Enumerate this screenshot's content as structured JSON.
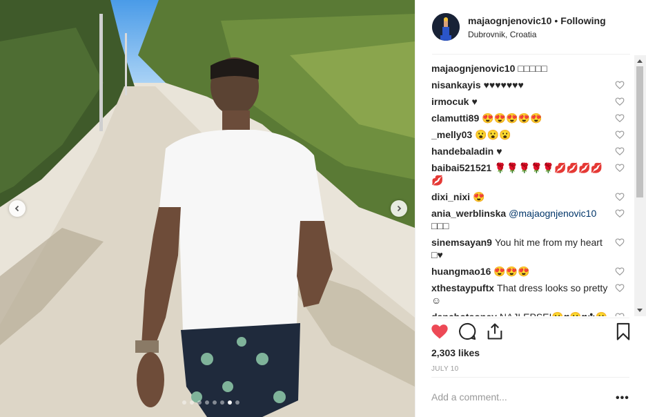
{
  "post": {
    "username": "majaognjenovic10",
    "separator": "•",
    "follow_status": "Following",
    "location": "Dubrovnik, Croatia"
  },
  "comments": [
    {
      "user": "majaognjenovic10",
      "text": "□□□□□",
      "likeable": false
    },
    {
      "user": "nisankayis",
      "text": "♥♥♥♥♥♥♥",
      "likeable": true
    },
    {
      "user": "irmocuk",
      "text": "♥",
      "likeable": true
    },
    {
      "user": "clamutti89",
      "text": "😍😍😍😍😍",
      "likeable": true
    },
    {
      "user": "_melly03",
      "text": "😮😮😮",
      "likeable": true
    },
    {
      "user": "handebaladin",
      "text": "♥",
      "likeable": true
    },
    {
      "user": "baibai521521",
      "text": "🌹🌹🌹🌹🌹💋💋💋💋💋",
      "likeable": true
    },
    {
      "user": "dixi_nixi",
      "text": "😍",
      "likeable": true
    },
    {
      "user": "ania_werblinska",
      "mention": "@majaognjenovic10",
      "text": "□□□",
      "likeable": true
    },
    {
      "user": "sinemsayan9",
      "text": "You hit me from my heart □♥",
      "likeable": true
    },
    {
      "user": "huangmao16",
      "text": "😍😍😍",
      "likeable": true
    },
    {
      "user": "xthestaypuftx",
      "text": "That dress looks so pretty ☺",
      "likeable": true
    },
    {
      "user": "danchotsonev",
      "text": "NAJLEPSE!😮♥😮♥✤😮 ♥♥♥♥♥😮♥♥",
      "likeable": true
    }
  ],
  "stats": {
    "likes": "2,303 likes",
    "date": "JULY 10"
  },
  "input": {
    "placeholder": "Add a comment...",
    "more": "•••"
  },
  "carousel": {
    "total": 8,
    "active_index": 6
  },
  "colors": {
    "heart_filled": "#ed4956",
    "mention": "#003569",
    "muted": "#999999"
  },
  "icons": {
    "prev": "chevron-left-icon",
    "next": "chevron-right-icon",
    "like": "heart-filled-icon",
    "comment": "comment-bubble-icon",
    "share": "share-icon",
    "save": "bookmark-icon",
    "comment_like": "heart-outline-icon"
  }
}
